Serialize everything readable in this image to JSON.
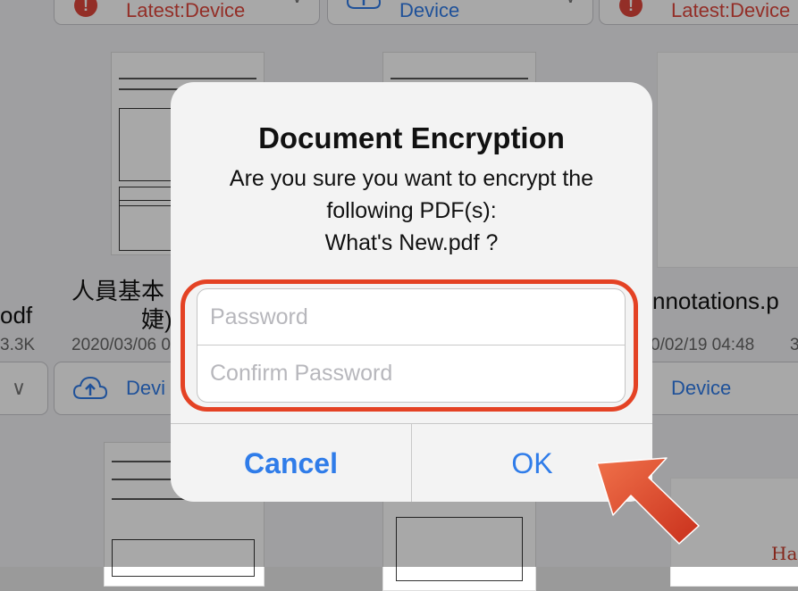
{
  "background": {
    "top_buttons": [
      {
        "label": "Latest:Device",
        "color": "#e0473c",
        "icon": "warning-icon"
      },
      {
        "label": "Device",
        "color": "#2f7ce9",
        "icon": "cloud-upload-icon"
      },
      {
        "label": "Latest:Device",
        "color": "#e0473c",
        "icon": "warning-icon"
      }
    ],
    "files": [
      {
        "name": "odf",
        "meta": "3.3K"
      },
      {
        "name_line1": "人員基本",
        "name_line2": "婕)",
        "meta": "2020/03/06 0"
      },
      {
        "name": "nnotations.p",
        "meta": "0/02/19 04:48",
        "meta2": "3"
      }
    ],
    "device_buttons": [
      {
        "label": "Devi"
      },
      {
        "label": "Device"
      }
    ],
    "thumb_text": "Hap"
  },
  "dialog": {
    "title": "Document Encryption",
    "message_line1": "Are you sure you want to encrypt the",
    "message_line2": "following PDF(s):",
    "message_line3": "What's New.pdf ?",
    "password_placeholder": "Password",
    "confirm_placeholder": "Confirm Password",
    "cancel_label": "Cancel",
    "ok_label": "OK"
  },
  "colors": {
    "accent": "#2f7ce9",
    "highlight": "#e44224",
    "warning": "#e0473c"
  }
}
